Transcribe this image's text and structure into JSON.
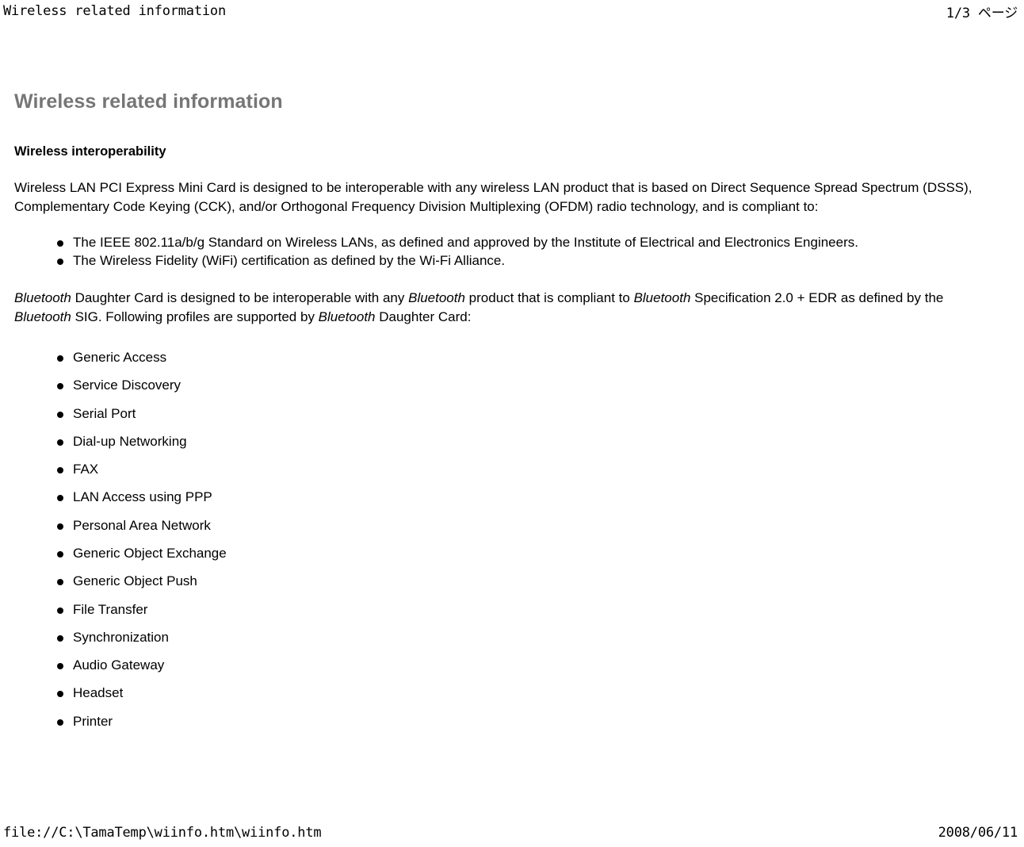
{
  "print_header": {
    "left": "Wireless related information",
    "right": "1/3 ページ"
  },
  "print_footer": {
    "left": "file://C:\\TamaTemp\\wiinfo.htm\\wiinfo.htm",
    "right": "2008/06/11"
  },
  "document": {
    "title": "Wireless related information",
    "title_color": "#767676",
    "section_heading": "Wireless interoperability",
    "intro_paragraph": "Wireless LAN PCI Express Mini Card is designed to be interoperable with any wireless LAN product that is based on Direct Sequence Spread Spectrum (DSSS), Complementary Code Keying (CCK), and/or Orthogonal Frequency Division Multiplexing (OFDM) radio technology, and is compliant to:",
    "standards_list": [
      "The IEEE 802.11a/b/g Standard on Wireless LANs, as defined and approved by the Institute of Electrical and Electronics Engineers.",
      "The Wireless Fidelity (WiFi) certification as defined by the Wi-Fi Alliance."
    ],
    "bluetooth_paragraph": {
      "segment_1_italic": "Bluetooth",
      "segment_2": " Daughter Card is designed to be interoperable with any ",
      "segment_3_italic": "Bluetooth",
      "segment_4": " product that is compliant to ",
      "segment_5_italic": "Bluetooth",
      "segment_6": " Specification 2.0 + EDR as defined by the ",
      "segment_7_italic": "Bluetooth",
      "segment_8": " SIG. Following profiles are supported by ",
      "segment_9_italic": "Bluetooth",
      "segment_10": " Daughter Card:"
    },
    "profiles_list": [
      "Generic Access",
      "Service Discovery",
      "Serial Port",
      "Dial-up Networking",
      "FAX",
      "LAN Access using PPP",
      "Personal Area Network",
      "Generic Object Exchange",
      "Generic Object Push",
      "File Transfer",
      "Synchronization",
      "Audio Gateway",
      "Headset",
      "Printer"
    ]
  }
}
